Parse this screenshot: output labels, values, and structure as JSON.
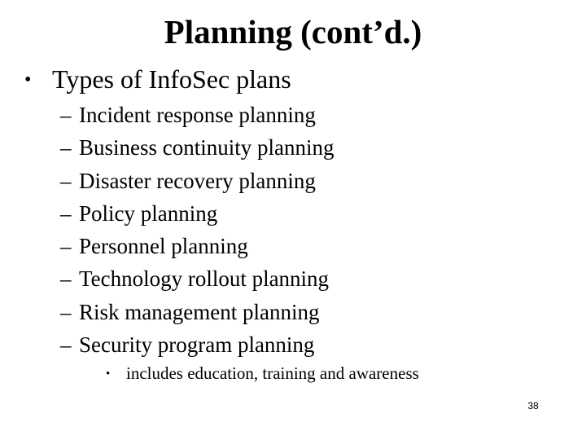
{
  "slide": {
    "title": "Planning (cont’d.)",
    "bullet_symbol": "•",
    "dash_symbol": "–",
    "main_point": "Types of InfoSec plans",
    "sub_points": [
      "Incident response planning",
      "Business continuity planning",
      "Disaster recovery planning",
      "Policy planning",
      "Personnel planning",
      "Technology rollout planning",
      "Risk management planning",
      "Security program planning"
    ],
    "sub_sub_point": "includes education, training and awareness",
    "page_number": "38"
  }
}
